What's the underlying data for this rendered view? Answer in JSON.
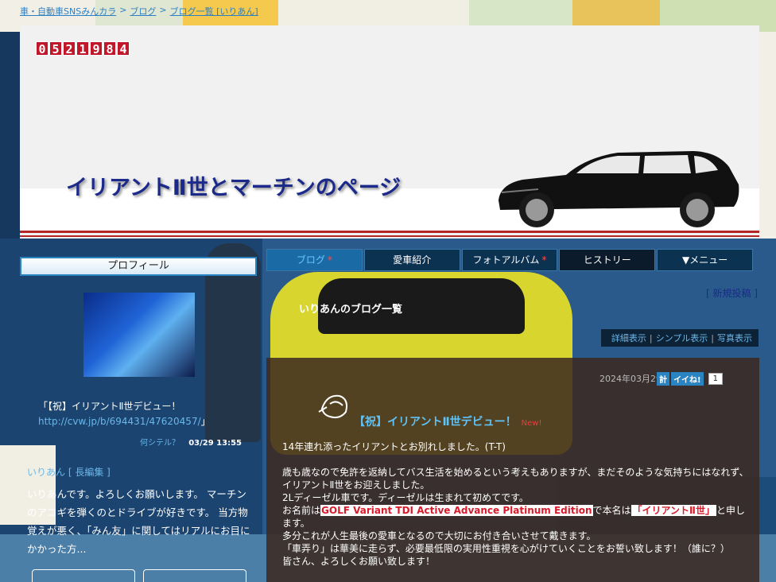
{
  "breadcrumb": {
    "items": [
      "車・自動車SNSみんカラ",
      "ブログ",
      "ブログ一覧 [いりあん]"
    ],
    "sep": ">"
  },
  "header": {
    "counter": [
      "0",
      "5",
      "2",
      "1",
      "9",
      "8",
      "4"
    ],
    "title": "イリアントⅡ世とマーチンのページ"
  },
  "sidebar": {
    "profile_heading": "プロフィール",
    "post_text": "「【祝】イリアントⅡ世デビュー！",
    "post_link": "http://cvw.jp/b/694431/47620457/",
    "post_close": "」",
    "post_meta_link": "何シテル？",
    "post_date": "03/29 13:55",
    "user_name": "いりあん",
    "user_dir": "[ 長編集 ]",
    "bio": "いりあんです。よろしくお願いします。 マーチンのアコギを弾くのとドライブが好きです。 当方物覚えが悪く、「みん友」に関してはリアルにお目にかかった方..."
  },
  "nav": {
    "items": [
      {
        "label": "ブログ",
        "asterisk": "*"
      },
      {
        "label": "愛車紹介",
        "asterisk": ""
      },
      {
        "label": "フォトアルバム",
        "asterisk": "*"
      },
      {
        "label": "ヒストリー",
        "asterisk": ""
      },
      {
        "label": "▼メニュー",
        "asterisk": ""
      }
    ]
  },
  "main": {
    "new_post_open": "[ ",
    "new_post": "新規投稿",
    "new_post_close": " ]",
    "list_title": "いりあんのブログ一覧",
    "view_modes": [
      "詳細表示",
      "シンプル表示",
      "写真表示"
    ],
    "view_sep": "|"
  },
  "entry": {
    "date": "2024年03月29日",
    "iine_label": "イイね!",
    "iine_count": "1",
    "iine_prefix": "計",
    "title": "【祝】イリアントⅡ世デビュー！",
    "new_badge": "New!",
    "p1": "14年連れ添ったイリアントとお別れしました。(T-T)",
    "p2": "歳も歳なので免許を返納してバス生活を始めるという考えもありますが、まだそのような気持ちにはなれず、イリアントⅡ世をお迎えしました。",
    "p3": "2Lディーゼル車です。ディーゼルは生まれて初めてです。",
    "p4_a": "お名前は",
    "p4_b": "GOLF Variant TDI Active Advance Platinum Edition",
    "p4_c": "で本名は",
    "p4_d": "「イリアントⅡ世」",
    "p4_e": "と申します。",
    "p5": "多分これが人生最後の愛車となるので大切にお付き合いさせて戴きます。",
    "p6": "「車弄り」は華美に走らず、必要最低限の実用性重視を心がけていくことをお誓い致します！（誰に？）",
    "p7": "皆さん、よろしくお願い致します！"
  },
  "colors": {
    "title_blue": "#1b2a8a",
    "link_blue": "#5fc2f5",
    "counter_red": "#c0182a",
    "header_rule": "#b42525",
    "highlight_red": "#d81a2a"
  }
}
